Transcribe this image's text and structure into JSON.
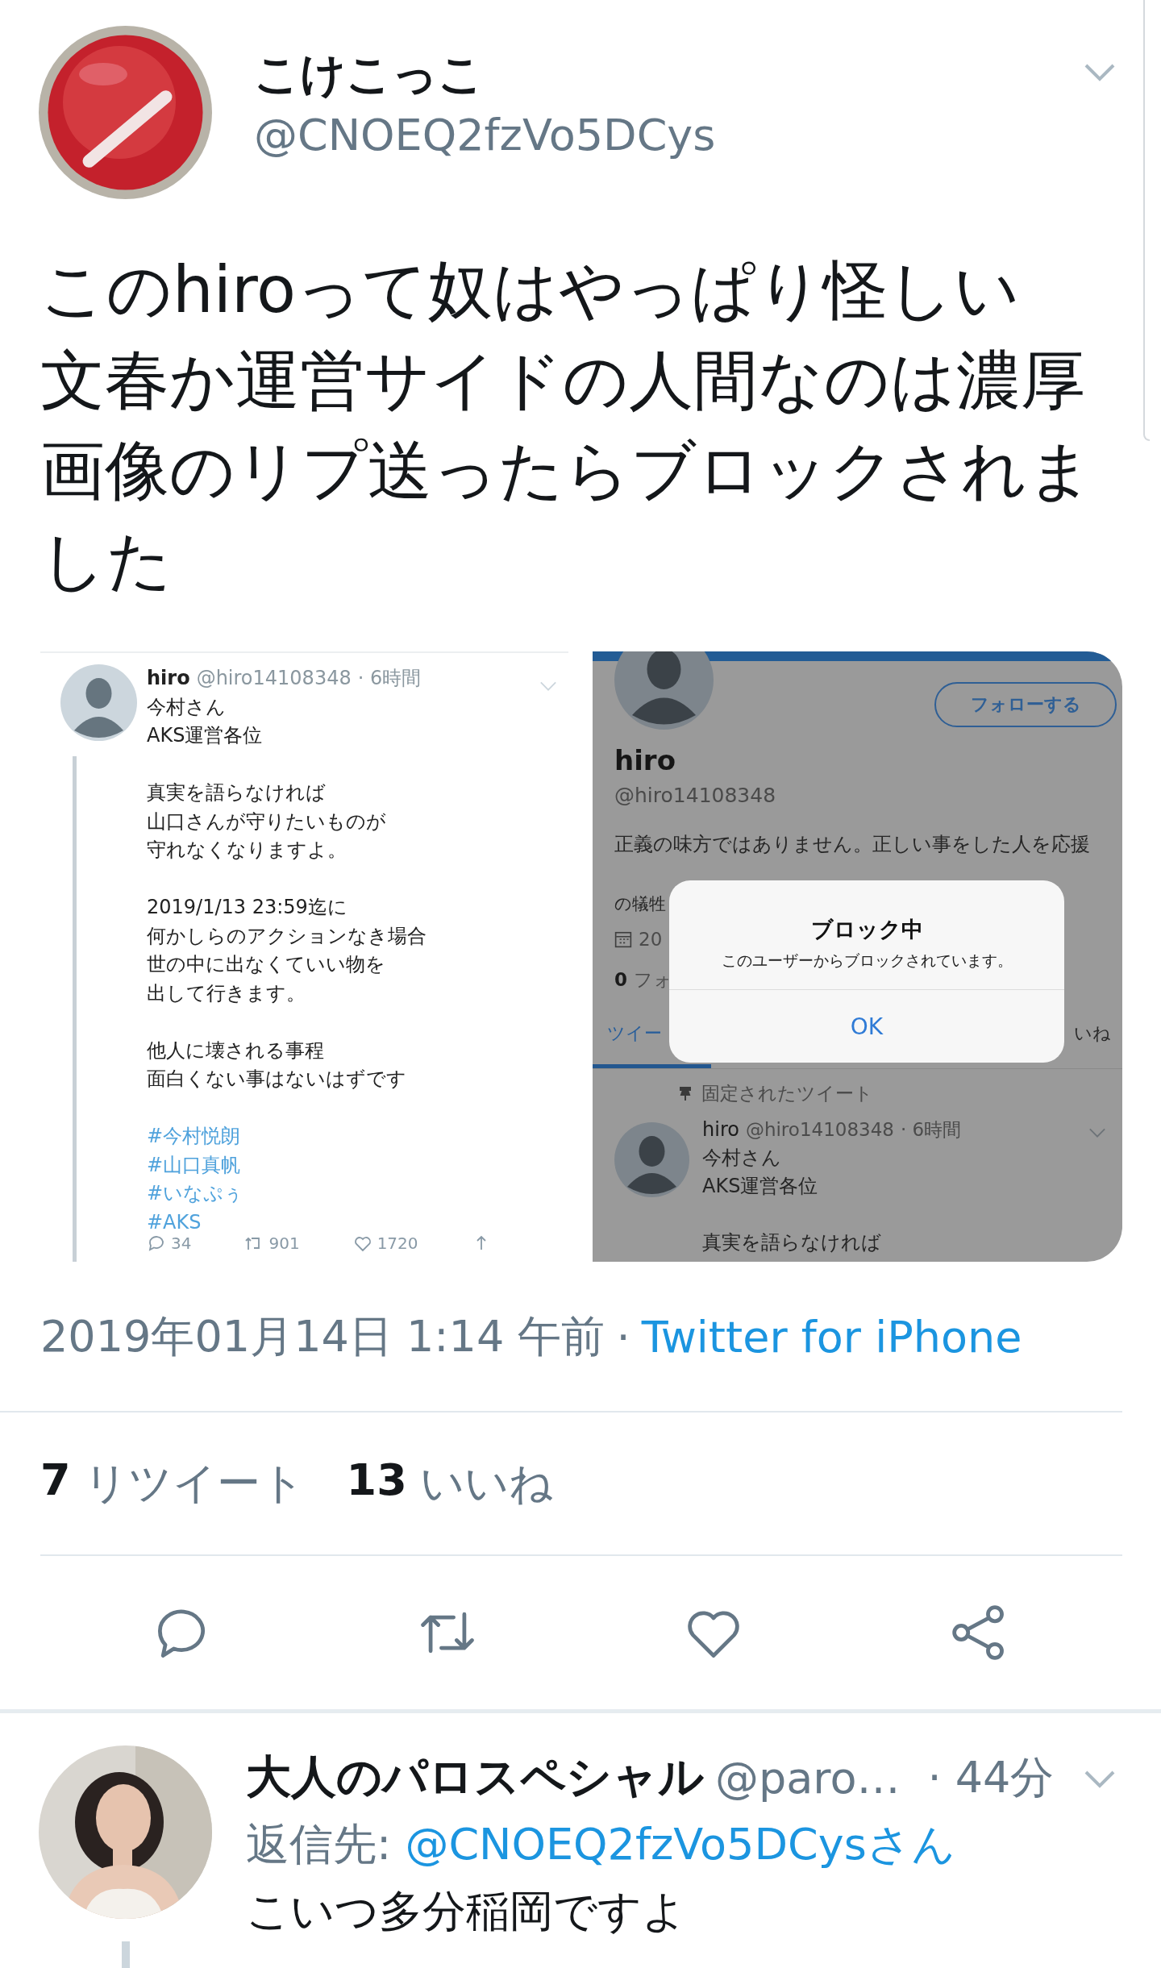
{
  "tweet": {
    "author": {
      "name": "こけこっこ",
      "handle": "@CNOEQ2fzVo5DCys"
    },
    "text_lines": [
      "このhiroって奴はやっぱり怪しい",
      "文春か運営サイドの人間なのは濃厚",
      "画像のリプ送ったらブロックされま",
      "した"
    ],
    "images": [
      {
        "kind": "tweet_screenshot",
        "name": "hiro",
        "handle": "@hiro14108348",
        "time": "· 6時間",
        "paragraphs": [
          [
            "今村さん",
            "AKS運営各位"
          ],
          [
            "真実を語らなければ",
            "山口さんが守りたいものが",
            "守れなくなりますよ。"
          ],
          [
            "2019/1/13 23:59迄に",
            "何かしらのアクションなき場合",
            "世の中に出なくていい物を",
            "出して行きます。"
          ],
          [
            "他人に壊される事程",
            "面白くない事はないはずです"
          ]
        ],
        "hashtags": [
          "#今村悦朗",
          "#山口真帆",
          "#いなぷぅ",
          "#AKS"
        ],
        "counts": [
          "34",
          "901",
          "1720"
        ]
      },
      {
        "kind": "profile_screenshot",
        "follow_button": "フォローする",
        "name": "hiro",
        "handle": "@hiro14108348",
        "bio": "正義の味方ではありません。正しい事をした人を応援",
        "bio_fragment": "の犠牲",
        "joined_fragment": "20",
        "following_fragment": {
          "count": "0",
          "label": "フォ"
        },
        "tabs": [
          {
            "label": "ツイー",
            "selected": true
          },
          {
            "label": "いね",
            "selected": false
          }
        ],
        "pinned_label": "固定されたツイート",
        "pinned_tweet": {
          "name": "hiro",
          "handle": "@hiro14108348",
          "time": "· 6時間",
          "lines": [
            "今村さん",
            "AKS運営各位"
          ],
          "after_gap": "真実を語らなければ"
        },
        "dialog": {
          "title": "ブロック中",
          "message": "このユーザーからブロックされています。",
          "button": "OK"
        }
      }
    ],
    "timestamp": "2019年01月14日 1:14 午前",
    "separator": "·",
    "source": "Twitter for iPhone",
    "stats": [
      {
        "count": "7",
        "label": "リツイート"
      },
      {
        "count": "13",
        "label": "いいね"
      }
    ]
  },
  "reply": {
    "name": "大人のパロスペシャル",
    "handle": "@paro…",
    "time": "· 44分",
    "reply_to_label": "返信先:",
    "reply_to": "@CNOEQ2fzVo5DCysさん",
    "text": "こいつ多分稲岡ですよ"
  }
}
